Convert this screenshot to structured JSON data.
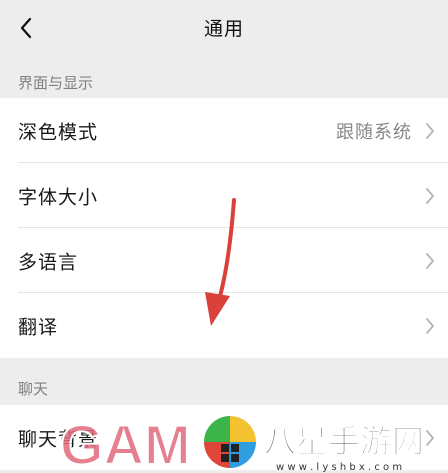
{
  "navbar": {
    "title": "通用",
    "back_icon": "chevron-left-icon"
  },
  "sections": [
    {
      "header": "界面与显示",
      "items": [
        {
          "label": "深色模式",
          "value": "跟随系统"
        },
        {
          "label": "字体大小",
          "value": ""
        },
        {
          "label": "多语言",
          "value": ""
        },
        {
          "label": "翻译",
          "value": ""
        }
      ]
    },
    {
      "header": "聊天",
      "items": [
        {
          "label": "聊天背景",
          "value": ""
        }
      ]
    }
  ],
  "watermark": {
    "left_text": "GAM",
    "right_text": "八星手游网",
    "url": "w w w . l y s h b x . c o m"
  },
  "colors": {
    "background": "#ededed",
    "row": "#ffffff",
    "annotation_arrow": "#d9413a"
  }
}
